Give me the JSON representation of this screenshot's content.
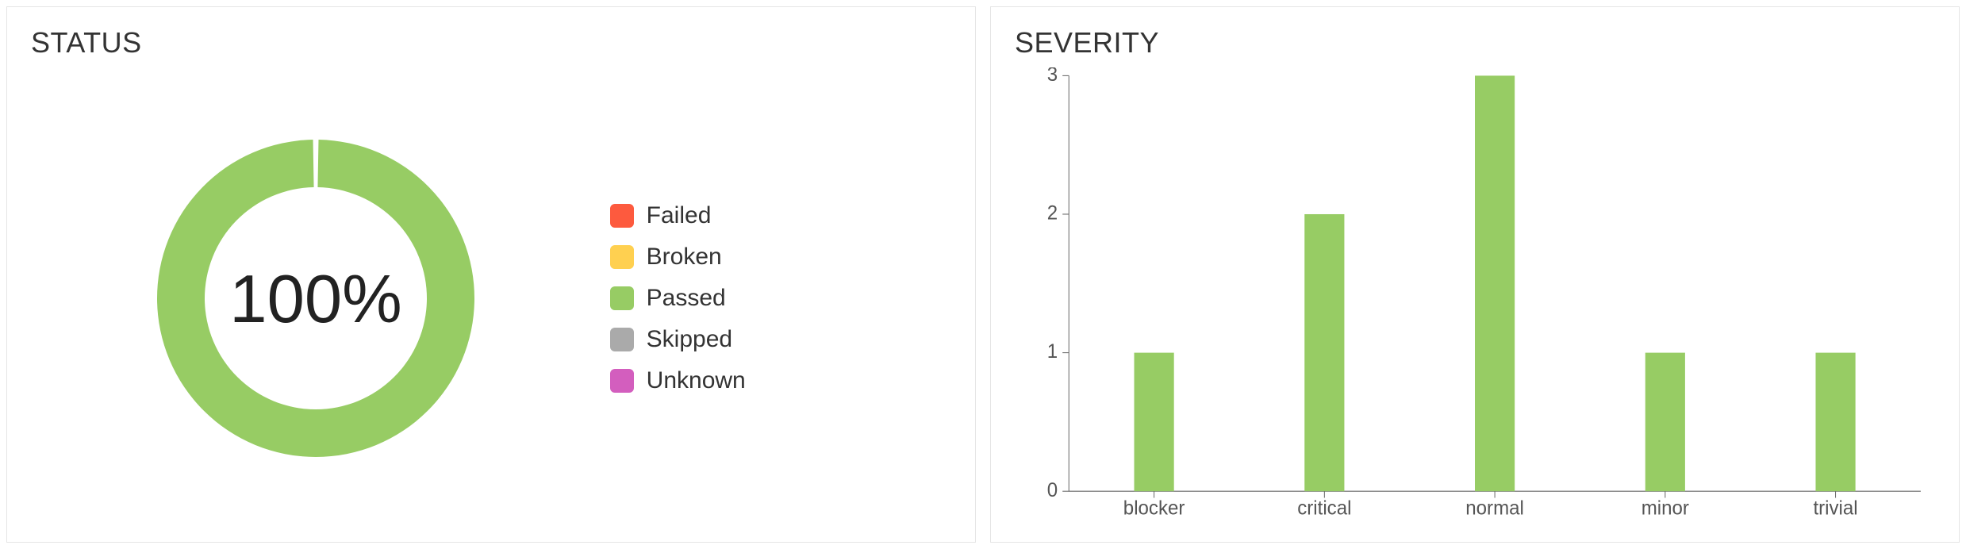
{
  "status_panel": {
    "title": "STATUS",
    "center_text": "100%",
    "legend": [
      {
        "label": "Failed",
        "color": "#fd5a3e"
      },
      {
        "label": "Broken",
        "color": "#ffd050"
      },
      {
        "label": "Passed",
        "color": "#97cc64"
      },
      {
        "label": "Skipped",
        "color": "#aaaaaa"
      },
      {
        "label": "Unknown",
        "color": "#d35ebe"
      }
    ]
  },
  "severity_panel": {
    "title": "SEVERITY"
  },
  "chart_data": [
    {
      "type": "pie",
      "title": "STATUS",
      "categories": [
        "Failed",
        "Broken",
        "Passed",
        "Skipped",
        "Unknown"
      ],
      "values": [
        0,
        0,
        100,
        0,
        0
      ],
      "colors": [
        "#fd5a3e",
        "#ffd050",
        "#97cc64",
        "#aaaaaa",
        "#d35ebe"
      ],
      "center_label": "100%"
    },
    {
      "type": "bar",
      "title": "SEVERITY",
      "categories": [
        "blocker",
        "critical",
        "normal",
        "minor",
        "trivial"
      ],
      "values": [
        1,
        2,
        3,
        1,
        1
      ],
      "ylim": [
        0,
        3
      ],
      "yticks": [
        0,
        1,
        2,
        3
      ],
      "bar_color": "#97cc64"
    }
  ]
}
